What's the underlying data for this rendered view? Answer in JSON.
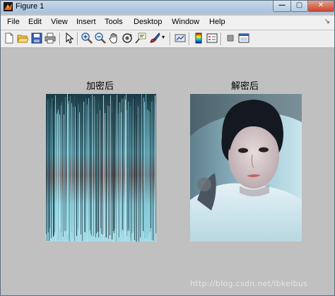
{
  "window": {
    "title": "Figure 1",
    "buttons": {
      "minimize": "—",
      "maximize": "▢",
      "close": "✕"
    }
  },
  "menu": [
    "File",
    "Edit",
    "View",
    "Insert",
    "Tools",
    "Desktop",
    "Window",
    "Help"
  ],
  "menu_arrow": "↘",
  "toolbar": {
    "icons": [
      "new-figure-icon",
      "open-file-icon",
      "save-icon",
      "print-icon",
      "edit-plot-arrow-icon",
      "zoom-in-icon",
      "zoom-out-icon",
      "pan-hand-icon",
      "rotate-3d-icon",
      "data-cursor-icon",
      "brush-icon",
      "link-plot-icon",
      "colorbar-icon",
      "legend-icon",
      "hide-plot-tools-icon",
      "show-plot-tools-icon"
    ]
  },
  "axes": [
    {
      "title": "加密后",
      "image": "encrypted image with vertical cyan streak noise"
    },
    {
      "title": "解密后",
      "image": "decrypted portrait photograph"
    }
  ],
  "watermark": "http://blog.csdn.net/lbkeibus",
  "colors": {
    "figure_bg": "#c0c0c0",
    "menubar_bg": "#f0f0f0",
    "title_bar": "#b8cde3"
  }
}
